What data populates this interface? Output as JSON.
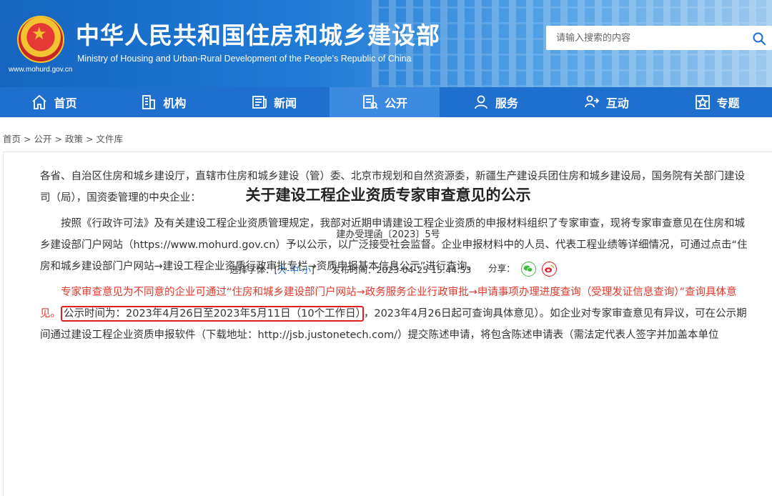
{
  "header": {
    "title": "中华人民共和国住房和城乡建设部",
    "subtitle": "Ministry of Housing and Urban-Rural Development of the People’s Republic of China",
    "url": "www.mohurd.gov.cn",
    "search_placeholder": "请输入搜索的内容"
  },
  "nav": {
    "items": [
      {
        "label": "首页",
        "icon": "home-icon"
      },
      {
        "label": "机构",
        "icon": "building-icon"
      },
      {
        "label": "新闻",
        "icon": "news-icon"
      },
      {
        "label": "公开",
        "icon": "disclosure-icon",
        "active": true
      },
      {
        "label": "服务",
        "icon": "service-icon"
      },
      {
        "label": "互动",
        "icon": "interaction-icon"
      },
      {
        "label": "专题",
        "icon": "topic-icon"
      }
    ]
  },
  "breadcrumb": {
    "items": [
      "首页",
      "公开",
      "政策",
      "文件库"
    ],
    "separator": ">"
  },
  "article": {
    "title": "关于建设工程企业资质专家审查意见的公示",
    "doc_number": "建办受理函〔2023〕5号",
    "font_size_label": "选择字体：",
    "font_size_open": "[",
    "font_size_large": "大",
    "font_size_medium": "中",
    "font_size_small": "小",
    "font_size_close": "]",
    "font_dash": "-",
    "publish_label": "发布时间：",
    "publish_time": "2023-04-25 15:44:53",
    "share_label": "分享：",
    "para1": "各省、自治区住房和城乡建设厅，直辖市住房和城乡建设（管）委、北京市规划和自然资源委，新疆生产建设兵团住房和城乡建设局，国务院有关部门建设司（局），国资委管理的中央企业：",
    "para2": "按照《行政许可法》及有关建设工程企业资质管理规定，我部对近期申请建设工程企业资质的申报材料组织了专家审查，现将专家审查意见在住房和城乡建设部门户网站（https://www.mohurd.gov.cn）予以公示，以广泛接受社会监督。企业申报材料中的人员、代表工程业绩等详细情况，可通过点击“住房和城乡建设部门户网站→建设工程企业资质行政审批专栏→资质申报基本信息公示”进行查询。",
    "para3_red": "专家审查意见为不同意的企业可通过“住房和城乡建设部门户网站→政务服务企业行政审批→申请事项办理进度查询（受理发证信息查询）”查询具体意见。",
    "para3_boxed": "公示时间为：2023年4月26日至2023年5月11日（10个工作日）",
    "para3_rest": "，2023年4月26日起可查询具体意见）。如企业对专家审查意见有异议，可在公示期间通过建设工程企业资质申报软件（下载地址：http://jsb.justonetech.com/）提交陈述申请，将包含陈述申请表（需法定代表人签字并加盖本单位"
  }
}
